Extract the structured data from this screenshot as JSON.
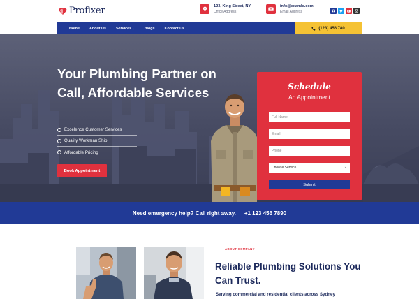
{
  "brand": {
    "name": "Profixer",
    "accent": "#e0313e",
    "navy": "#213a96",
    "yellow": "#f5c234"
  },
  "header": {
    "address": {
      "line1": "123, King Street, NY",
      "line2": "Office Address",
      "icon": "map-pin-icon"
    },
    "email": {
      "line1": "info@examle.com",
      "line2": "Email Address",
      "icon": "mail-icon"
    },
    "socials": [
      {
        "name": "facebook-icon",
        "color": "#213a96"
      },
      {
        "name": "twitter-icon",
        "color": "#1da1f2"
      },
      {
        "name": "youtube-icon",
        "color": "#e0313e"
      },
      {
        "name": "instagram-icon",
        "color": "#333333"
      }
    ]
  },
  "nav": {
    "items": [
      "Home",
      "About Us",
      "Services",
      "Blogs",
      "Contact Us"
    ],
    "phone": "(123) 456 780"
  },
  "hero": {
    "title": "Your Plumbing Partner on Call, Affordable Services",
    "features": [
      "Excelence Customer Services",
      "Quality Workman Ship",
      "Affordable Pricing"
    ],
    "cta": "Book Appointment"
  },
  "form": {
    "title": "Schedule",
    "subtitle": "An Appointment",
    "name_placeholder": "Full Name",
    "email_placeholder": "Email",
    "phone_placeholder": "Phone",
    "service_selected": "Choose Service",
    "submit": "Submit"
  },
  "emergency": {
    "text": "Need emergency help? Call right away.",
    "phone": "+1 123 456 7890"
  },
  "about": {
    "tag": "ABOUT COMPANY",
    "title": "Reliable Plumbing Solutions You Can Trust.",
    "desc": "Serving commercial and residential clients across Sydney"
  }
}
